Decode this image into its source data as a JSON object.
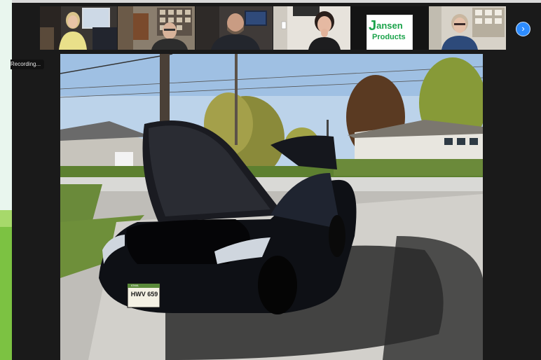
{
  "recording": {
    "label": "Recording..."
  },
  "thumbnails": [
    {
      "kind": "video",
      "who": "participant-1"
    },
    {
      "kind": "video",
      "who": "participant-2"
    },
    {
      "kind": "video",
      "who": "participant-3"
    },
    {
      "kind": "video",
      "who": "participant-4"
    },
    {
      "kind": "logo",
      "logo_initial": "J",
      "logo_rest": "ansen",
      "logo_line2": "Products"
    },
    {
      "kind": "video",
      "who": "participant-6"
    }
  ],
  "navigation": {
    "next_icon": "chevron-right-icon",
    "next_glyph": "›"
  },
  "screen_share": {
    "license_plate": "HWV 659",
    "plate_state": "IOWA"
  },
  "colors": {
    "accent": "#2d8cff",
    "lime": "#7cc242",
    "logo_green": "#1aa34a"
  }
}
